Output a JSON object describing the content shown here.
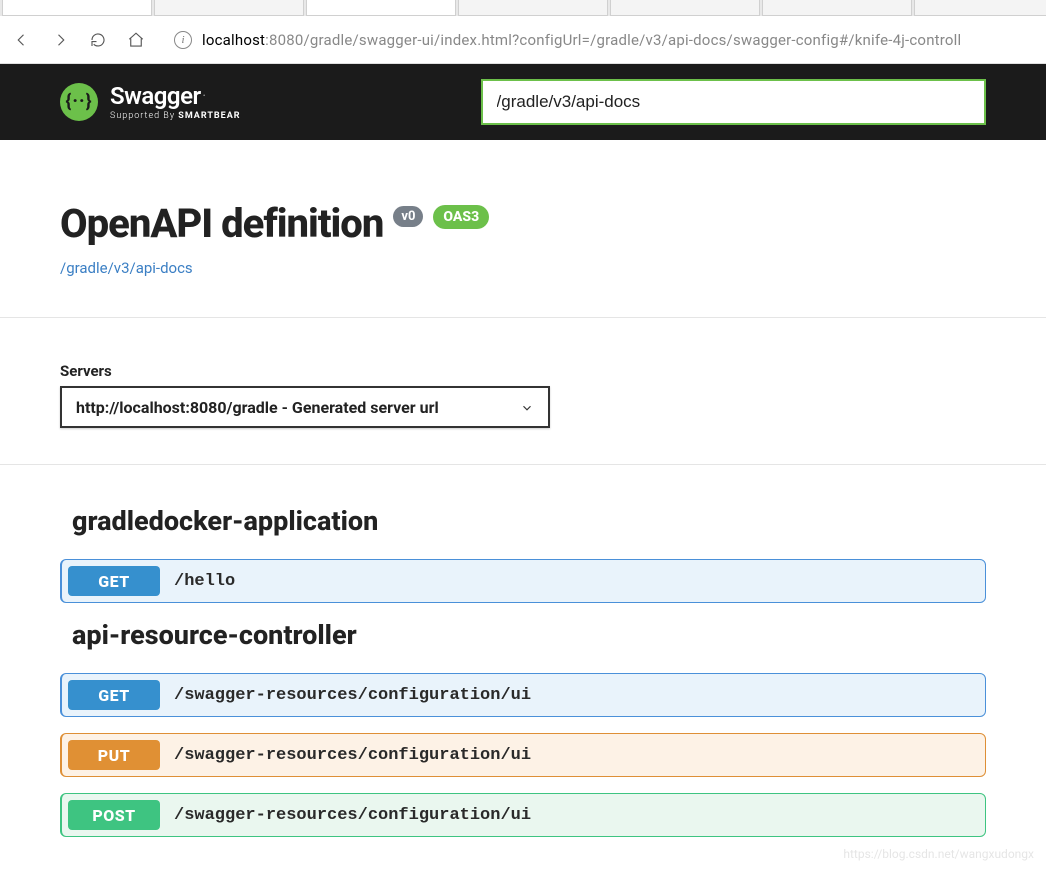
{
  "browser": {
    "url_host": "localhost",
    "url_rest": ":8080/gradle/swagger-ui/index.html?configUrl=/gradle/v3/api-docs/swagger-config#/knife-4j-controll"
  },
  "topbar": {
    "logo_name": "Swagger",
    "supported_by": "Supported By ",
    "smartbear": "SMARTBEAR",
    "spec_input_value": "/gradle/v3/api-docs"
  },
  "header": {
    "title": "OpenAPI definition",
    "version": "v0",
    "oas": "OAS3",
    "docs_link": "/gradle/v3/api-docs"
  },
  "servers": {
    "label": "Servers",
    "selected": "http://localhost:8080/gradle - Generated server url"
  },
  "tags": [
    {
      "name": "gradledocker-application",
      "ops": [
        {
          "method": "GET",
          "method_class": "get",
          "path": "/hello"
        }
      ]
    },
    {
      "name": "api-resource-controller",
      "ops": [
        {
          "method": "GET",
          "method_class": "get",
          "path": "/swagger-resources/configuration/ui"
        },
        {
          "method": "PUT",
          "method_class": "put",
          "path": "/swagger-resources/configuration/ui"
        },
        {
          "method": "POST",
          "method_class": "post",
          "path": "/swagger-resources/configuration/ui"
        }
      ]
    }
  ],
  "watermark": "https://blog.csdn.net/wangxudongx"
}
